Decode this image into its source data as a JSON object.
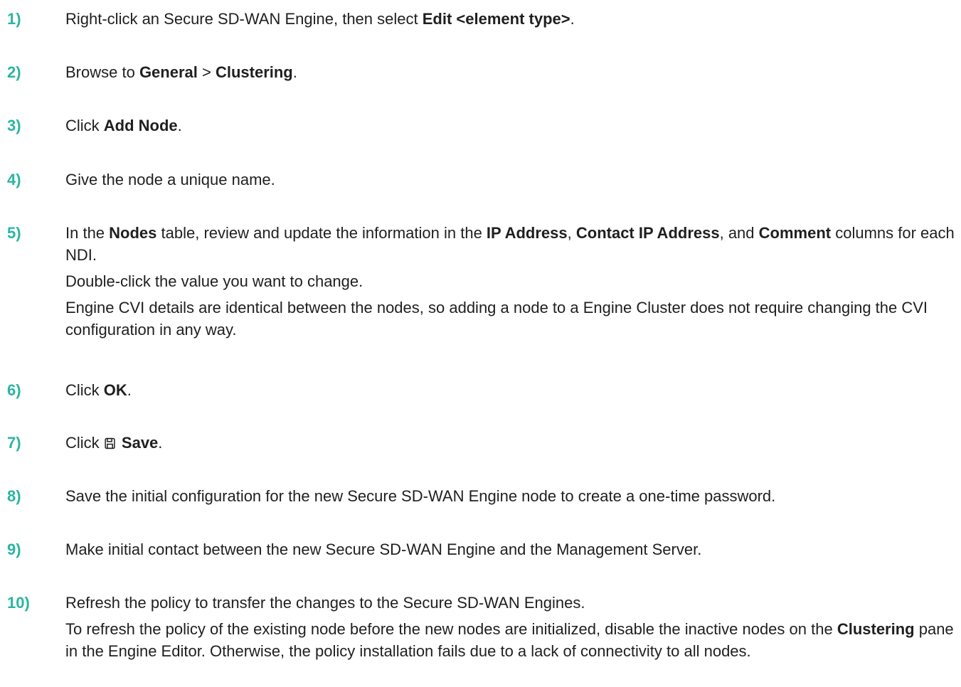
{
  "steps": [
    {
      "number": "1)",
      "parts": [
        "Right-click an Secure SD-WAN Engine, then select ",
        "Edit <element type>",
        "."
      ]
    },
    {
      "number": "2)",
      "parts": [
        "Browse to ",
        "General",
        " > ",
        "Clustering",
        "."
      ]
    },
    {
      "number": "3)",
      "parts": [
        "Click ",
        "Add Node",
        "."
      ]
    },
    {
      "number": "4)",
      "text": "Give the node a unique name."
    },
    {
      "number": "5)",
      "parts": [
        "In the ",
        "Nodes",
        " table, review and update the information in the ",
        "IP Address",
        ", ",
        "Contact IP Address",
        ", and ",
        "Comment",
        " columns for each NDI."
      ],
      "sub1": "Double-click the value you want to change.",
      "sub2": "Engine CVI details are identical between the nodes, so adding a node to a Engine Cluster does not require changing the CVI configuration in any way."
    },
    {
      "number": "6)",
      "parts": [
        "Click ",
        "OK",
        "."
      ]
    },
    {
      "number": "7)",
      "parts": [
        "Click ",
        "Save",
        "."
      ],
      "icon": "save-icon"
    },
    {
      "number": "8)",
      "text": "Save the initial configuration for the new Secure SD-WAN Engine node to create a one-time password."
    },
    {
      "number": "9)",
      "text": "Make initial contact between the new Secure SD-WAN Engine and the Management Server."
    },
    {
      "number": "10)",
      "text": "Refresh the policy to transfer the changes to the Secure SD-WAN Engines.",
      "parts": [
        "To refresh the policy of the existing node before the new nodes are initialized, disable the inactive nodes on the ",
        "Clustering",
        " pane in the Engine Editor. Otherwise, the policy installation fails due to a lack of connectivity to all nodes."
      ]
    }
  ],
  "colors": {
    "step_number": "#2bb5a0",
    "text": "#1f1f1f"
  }
}
